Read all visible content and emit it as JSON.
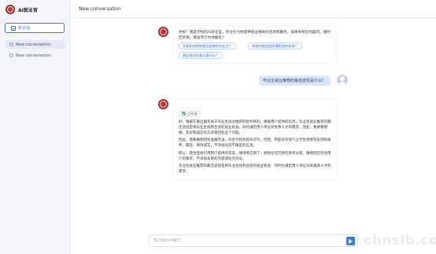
{
  "sidebar": {
    "brand": "AI就业官",
    "new_chat_label": "新对话",
    "conversations": [
      {
        "label": "New conversation"
      },
      {
        "label": "New conversation"
      }
    ]
  },
  "header": {
    "title": "New conversation"
  },
  "messages": {
    "welcome": {
      "text": "你好！我是学校的AI就业官，专注于为你提供就业相关的咨询和服务。如果你有任何疑问，随时告诉我，我会尽力为你解答！",
      "suggestions": [
        "学校如何帮助就业困难的毕业生？",
        "学校的就业指导课程如何安排？",
        "就业指导的意义是什么？"
      ]
    },
    "user_question": "毕业生就业推荐的最佳途径是什么？",
    "answer": {
      "tag": "工作流",
      "paragraphs": [
        "好，根据在重启服务关于毕业生就业推荐的指导目的。根据用户提供的信息，毕业生就业推荐的最佳途径是将毕业生找到合适的就业机会，同时满足用人单位对优秀人才的需求。因此，我要看明确、友好和诚实的方式来回答这个问题。",
        "因此，我要确保回答准确无误，符合学校的指导方针。然后，用友好的语气让学生感受到支持和关怀。最后，保持诚实，不添加任何不确定的信息。",
        "所以，我会直接引用用户提供的答案，保持简洁明了，避免任何冗余的思考过程。确保回答符合用户的要求，不添加多余的内容或标点符号。",
        "毕业生就业推荐的最佳途径是将毕业生找到合适的就业机会，同时也满足用人单位对高素质人才的需求。"
      ]
    }
  },
  "input": {
    "placeholder": "有问题问AI聊天"
  },
  "watermark": "chnslb.com",
  "colors": {
    "accent": "#3b7ae0",
    "brand_red": "#b83a3a",
    "user_bubble": "#dbe6fb",
    "success": "#2fa564"
  },
  "icons": {
    "new_chat": "new-chat-icon",
    "conversation": "chat-bubble-icon",
    "send": "send-icon",
    "status": "check-circle-icon"
  }
}
